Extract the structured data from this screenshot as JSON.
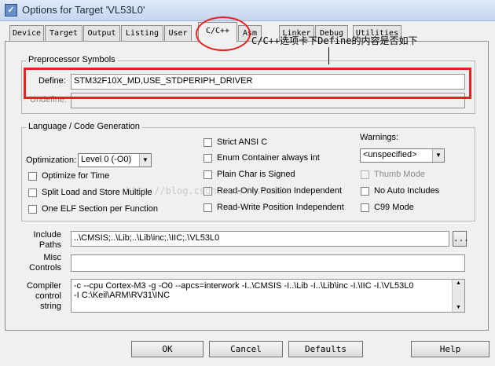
{
  "window": {
    "title": "Options for Target 'VL53L0'",
    "icon": "app-window-icon"
  },
  "tabs": [
    {
      "label": "Device"
    },
    {
      "label": "Target"
    },
    {
      "label": "Output"
    },
    {
      "label": "Listing"
    },
    {
      "label": "User"
    },
    {
      "label": "C/C++",
      "active": true
    },
    {
      "label": "Asm"
    },
    {
      "label": "Linker"
    },
    {
      "label": "Debug"
    },
    {
      "label": "Utilities"
    }
  ],
  "annotation": {
    "text": "C/C++选项卡下Define的内容是否如下",
    "highlight_color": "#e82020"
  },
  "preprocessor": {
    "legend": "Preprocessor Symbols",
    "define_label": "Define:",
    "define_value": "STM32F10X_MD,USE_STDPERIPH_DRIVER",
    "undefine_label": "Undefine:",
    "undefine_value": ""
  },
  "language": {
    "legend": "Language / Code Generation",
    "optimization_label": "Optimization:",
    "optimization_value": "Level 0 (-O0)",
    "checks_left": [
      {
        "label": "Optimize for Time",
        "checked": false
      },
      {
        "label": "Split Load and Store Multiple",
        "checked": false
      },
      {
        "label": "One ELF Section per Function",
        "checked": false
      }
    ],
    "checks_mid": [
      {
        "label": "Strict ANSI C",
        "checked": false
      },
      {
        "label": "Enum Container always int",
        "checked": false
      },
      {
        "label": "Plain Char is Signed",
        "checked": false
      },
      {
        "label": "Read-Only Position Independent",
        "checked": false
      },
      {
        "label": "Read-Write Position Independent",
        "checked": false
      }
    ],
    "warnings_label": "Warnings:",
    "warnings_value": "<unspecified>",
    "checks_right": [
      {
        "label": "Thumb Mode",
        "checked": false,
        "disabled": true
      },
      {
        "label": "No Auto Includes",
        "checked": false
      },
      {
        "label": "C99 Mode",
        "checked": false
      }
    ]
  },
  "paths": {
    "include_label": "Include\nPaths",
    "include_value": "..\\CMSIS;..\\Lib;..\\Lib\\inc;.\\IIC;.\\VL53L0",
    "browse_label": "...",
    "misc_label": "Misc\nControls",
    "misc_value": "",
    "compiler_label": "Compiler\ncontrol\nstring",
    "compiler_line1": "-c --cpu Cortex-M3 -g -O0 --apcs=interwork -I..\\CMSIS -I..\\Lib -I..\\Lib\\inc -I.\\IIC -I.\\VL53L0",
    "compiler_line2": "-I C:\\Keil\\ARM\\RV31\\INC"
  },
  "buttons": {
    "ok": "OK",
    "cancel": "Cancel",
    "defaults": "Defaults",
    "help": "Help"
  },
  "watermark": "http://blog.csdn.net/...tcsdn"
}
